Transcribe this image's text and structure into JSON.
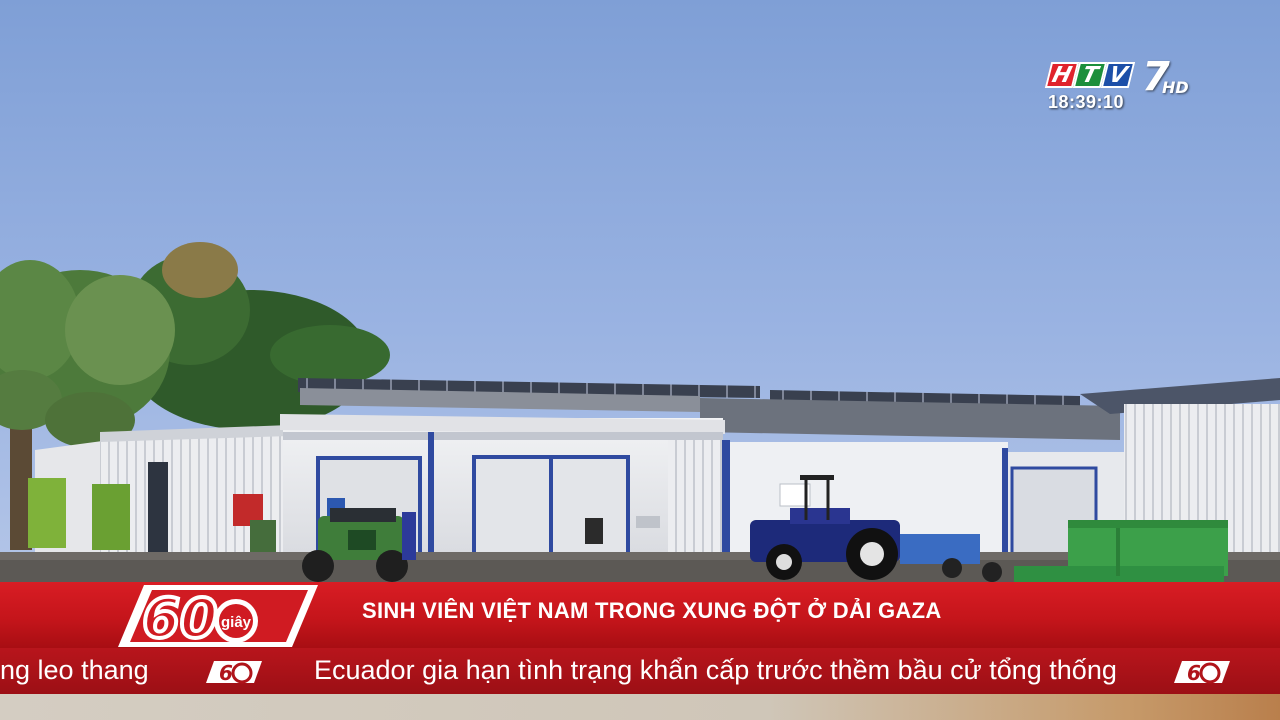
{
  "channel": {
    "logo_letters": [
      "H",
      "T",
      "V"
    ],
    "logo_number": "7",
    "logo_suffix": "HD",
    "clock": "18:39:10"
  },
  "program_badge": {
    "number": "60",
    "word": "giây"
  },
  "headline": "SINH VIÊN VIỆT NAM TRONG XUNG ĐỘT Ở DẢI GAZA",
  "ticker": {
    "items": [
      "ng leo thang",
      "Ecuador gia hạn tình trạng khẩn cấp trước thềm bầu cử tổng thống"
    ],
    "separator_icon": "60-giay-logo-icon"
  },
  "colors": {
    "headline_red": "#c5151b",
    "ticker_red": "#a51219",
    "sky": "#93afe0"
  }
}
